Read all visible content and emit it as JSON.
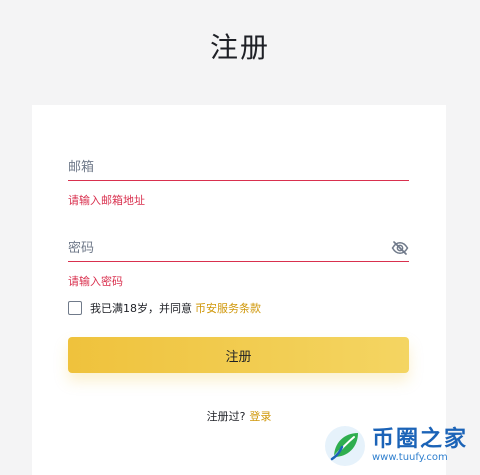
{
  "page": {
    "title": "注册"
  },
  "form": {
    "email": {
      "placeholder": "邮箱",
      "value": "",
      "error": "请输入邮箱地址"
    },
    "password": {
      "placeholder": "密码",
      "value": "",
      "error": "请输入密码",
      "toggle_icon": "eye-slash-icon"
    },
    "agreement": {
      "checked": false,
      "text": "我已满18岁，并同意",
      "link_text": "币安服务条款"
    },
    "submit_label": "注册",
    "login_prompt": "注册过?",
    "login_link": "登录"
  },
  "watermark": {
    "name": "币圈之家",
    "url": "www.tuufy.com",
    "icon": "leaf-logo-icon"
  },
  "colors": {
    "accent": "#f0b90b",
    "error": "#d9304e",
    "link": "#d0980b",
    "background": "#f4f4f5",
    "card": "#ffffff",
    "text": "#1e2026"
  }
}
